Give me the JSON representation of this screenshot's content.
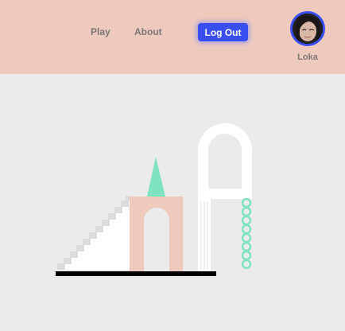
{
  "nav": {
    "play_label": "Play",
    "about_label": "About",
    "logout_label": "Log Out"
  },
  "user": {
    "name": "Loka",
    "avatar_icon": "user-photo"
  },
  "colors": {
    "header_bg": "#eecabe",
    "page_bg": "#ebebeb",
    "accent": "#3a4ff2",
    "mint": "#7fe3bf",
    "peach": "#eecabe",
    "ground": "#000000"
  },
  "scene": {
    "description_icons": [
      "staircase",
      "archway",
      "cone",
      "arched-window",
      "column",
      "chain"
    ]
  }
}
